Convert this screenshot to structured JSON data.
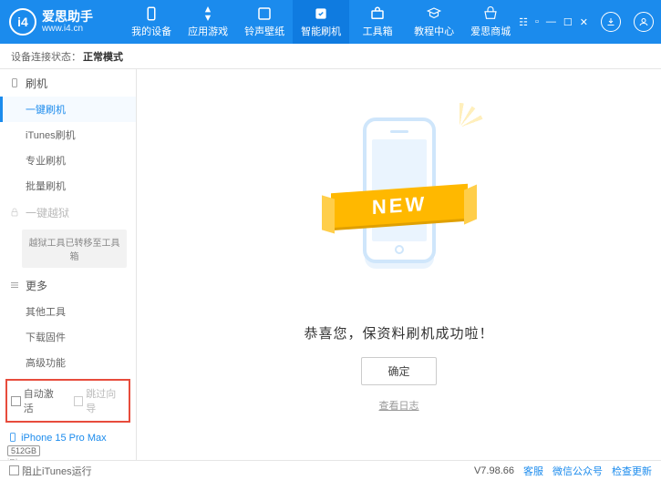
{
  "brand": {
    "title": "爱思助手",
    "sub": "www.i4.cn",
    "logo_letter": "i4"
  },
  "nav": [
    {
      "label": "我的设备"
    },
    {
      "label": "应用游戏"
    },
    {
      "label": "铃声壁纸"
    },
    {
      "label": "智能刷机"
    },
    {
      "label": "工具箱"
    },
    {
      "label": "教程中心"
    },
    {
      "label": "爱思商城"
    }
  ],
  "status": {
    "label": "设备连接状态：",
    "value": "正常模式"
  },
  "sidebar": {
    "group_flash": "刷机",
    "items_flash": [
      "一键刷机",
      "iTunes刷机",
      "专业刷机",
      "批量刷机"
    ],
    "group_jb": "一键越狱",
    "jb_note": "越狱工具已转移至工具箱",
    "group_more": "更多",
    "items_more": [
      "其他工具",
      "下载固件",
      "高级功能"
    ],
    "chk_auto": "自动激活",
    "chk_skip": "跳过向导"
  },
  "device": {
    "name": "iPhone 15 Pro Max",
    "storage": "512GB",
    "type": "iPhone"
  },
  "main": {
    "ribbon": "NEW",
    "message": "恭喜您，保资料刷机成功啦！",
    "ok": "确定",
    "log": "查看日志"
  },
  "footer": {
    "block_itunes": "阻止iTunes运行",
    "version": "V7.98.66",
    "links": [
      "客服",
      "微信公众号",
      "检查更新"
    ]
  }
}
